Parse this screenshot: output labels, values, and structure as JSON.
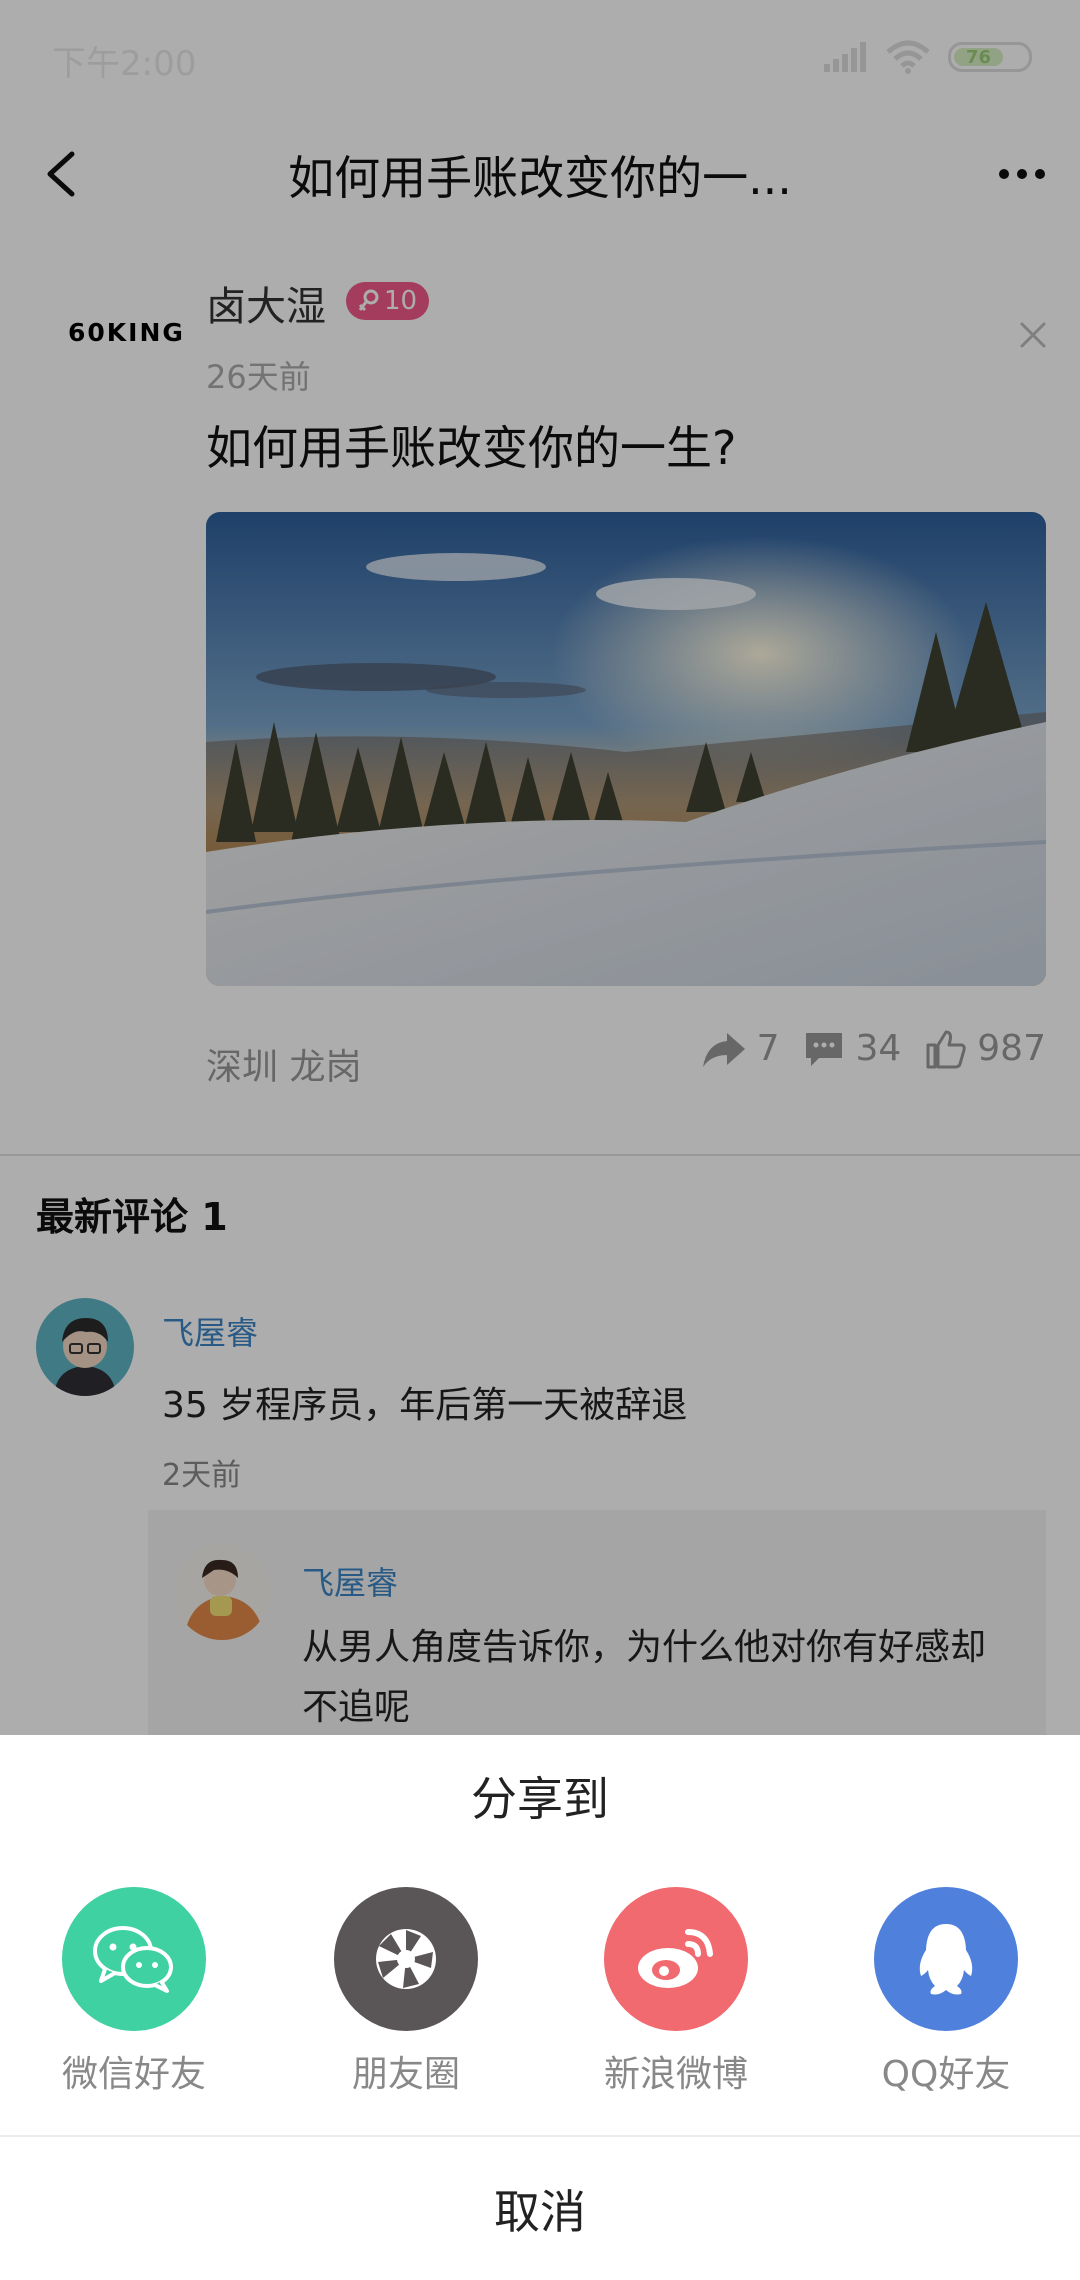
{
  "status_bar": {
    "time": "下午2:00",
    "battery": "76"
  },
  "header": {
    "title": "如何用手账改变你的一..."
  },
  "post": {
    "brand_logo": "60KING",
    "author": "卤大湿",
    "level": "10",
    "time": "26天前",
    "title": "如何用手账改变你的一生?",
    "location": "深圳 龙岗",
    "shares": "7",
    "comments": "34",
    "likes": "987"
  },
  "comments_section": {
    "title": "最新评论 1",
    "comment": {
      "user": "飞屋睿",
      "text": "35 岁程序员，年后第一天被辞退",
      "time": "2天前",
      "reply": {
        "user": "飞屋睿",
        "text": "从男人角度告诉你，为什么他对你有好感却不追呢"
      }
    }
  },
  "share_sheet": {
    "title": "分享到",
    "items": [
      {
        "label": "微信好友",
        "icon": "wechat-icon",
        "color": "#3fd1a1"
      },
      {
        "label": "朋友圈",
        "icon": "moments-icon",
        "color": "#5a5556"
      },
      {
        "label": "新浪微博",
        "icon": "weibo-icon",
        "color": "#f06a6f"
      },
      {
        "label": "QQ好友",
        "icon": "qq-icon",
        "color": "#4f80dc"
      }
    ],
    "cancel": "取消"
  }
}
